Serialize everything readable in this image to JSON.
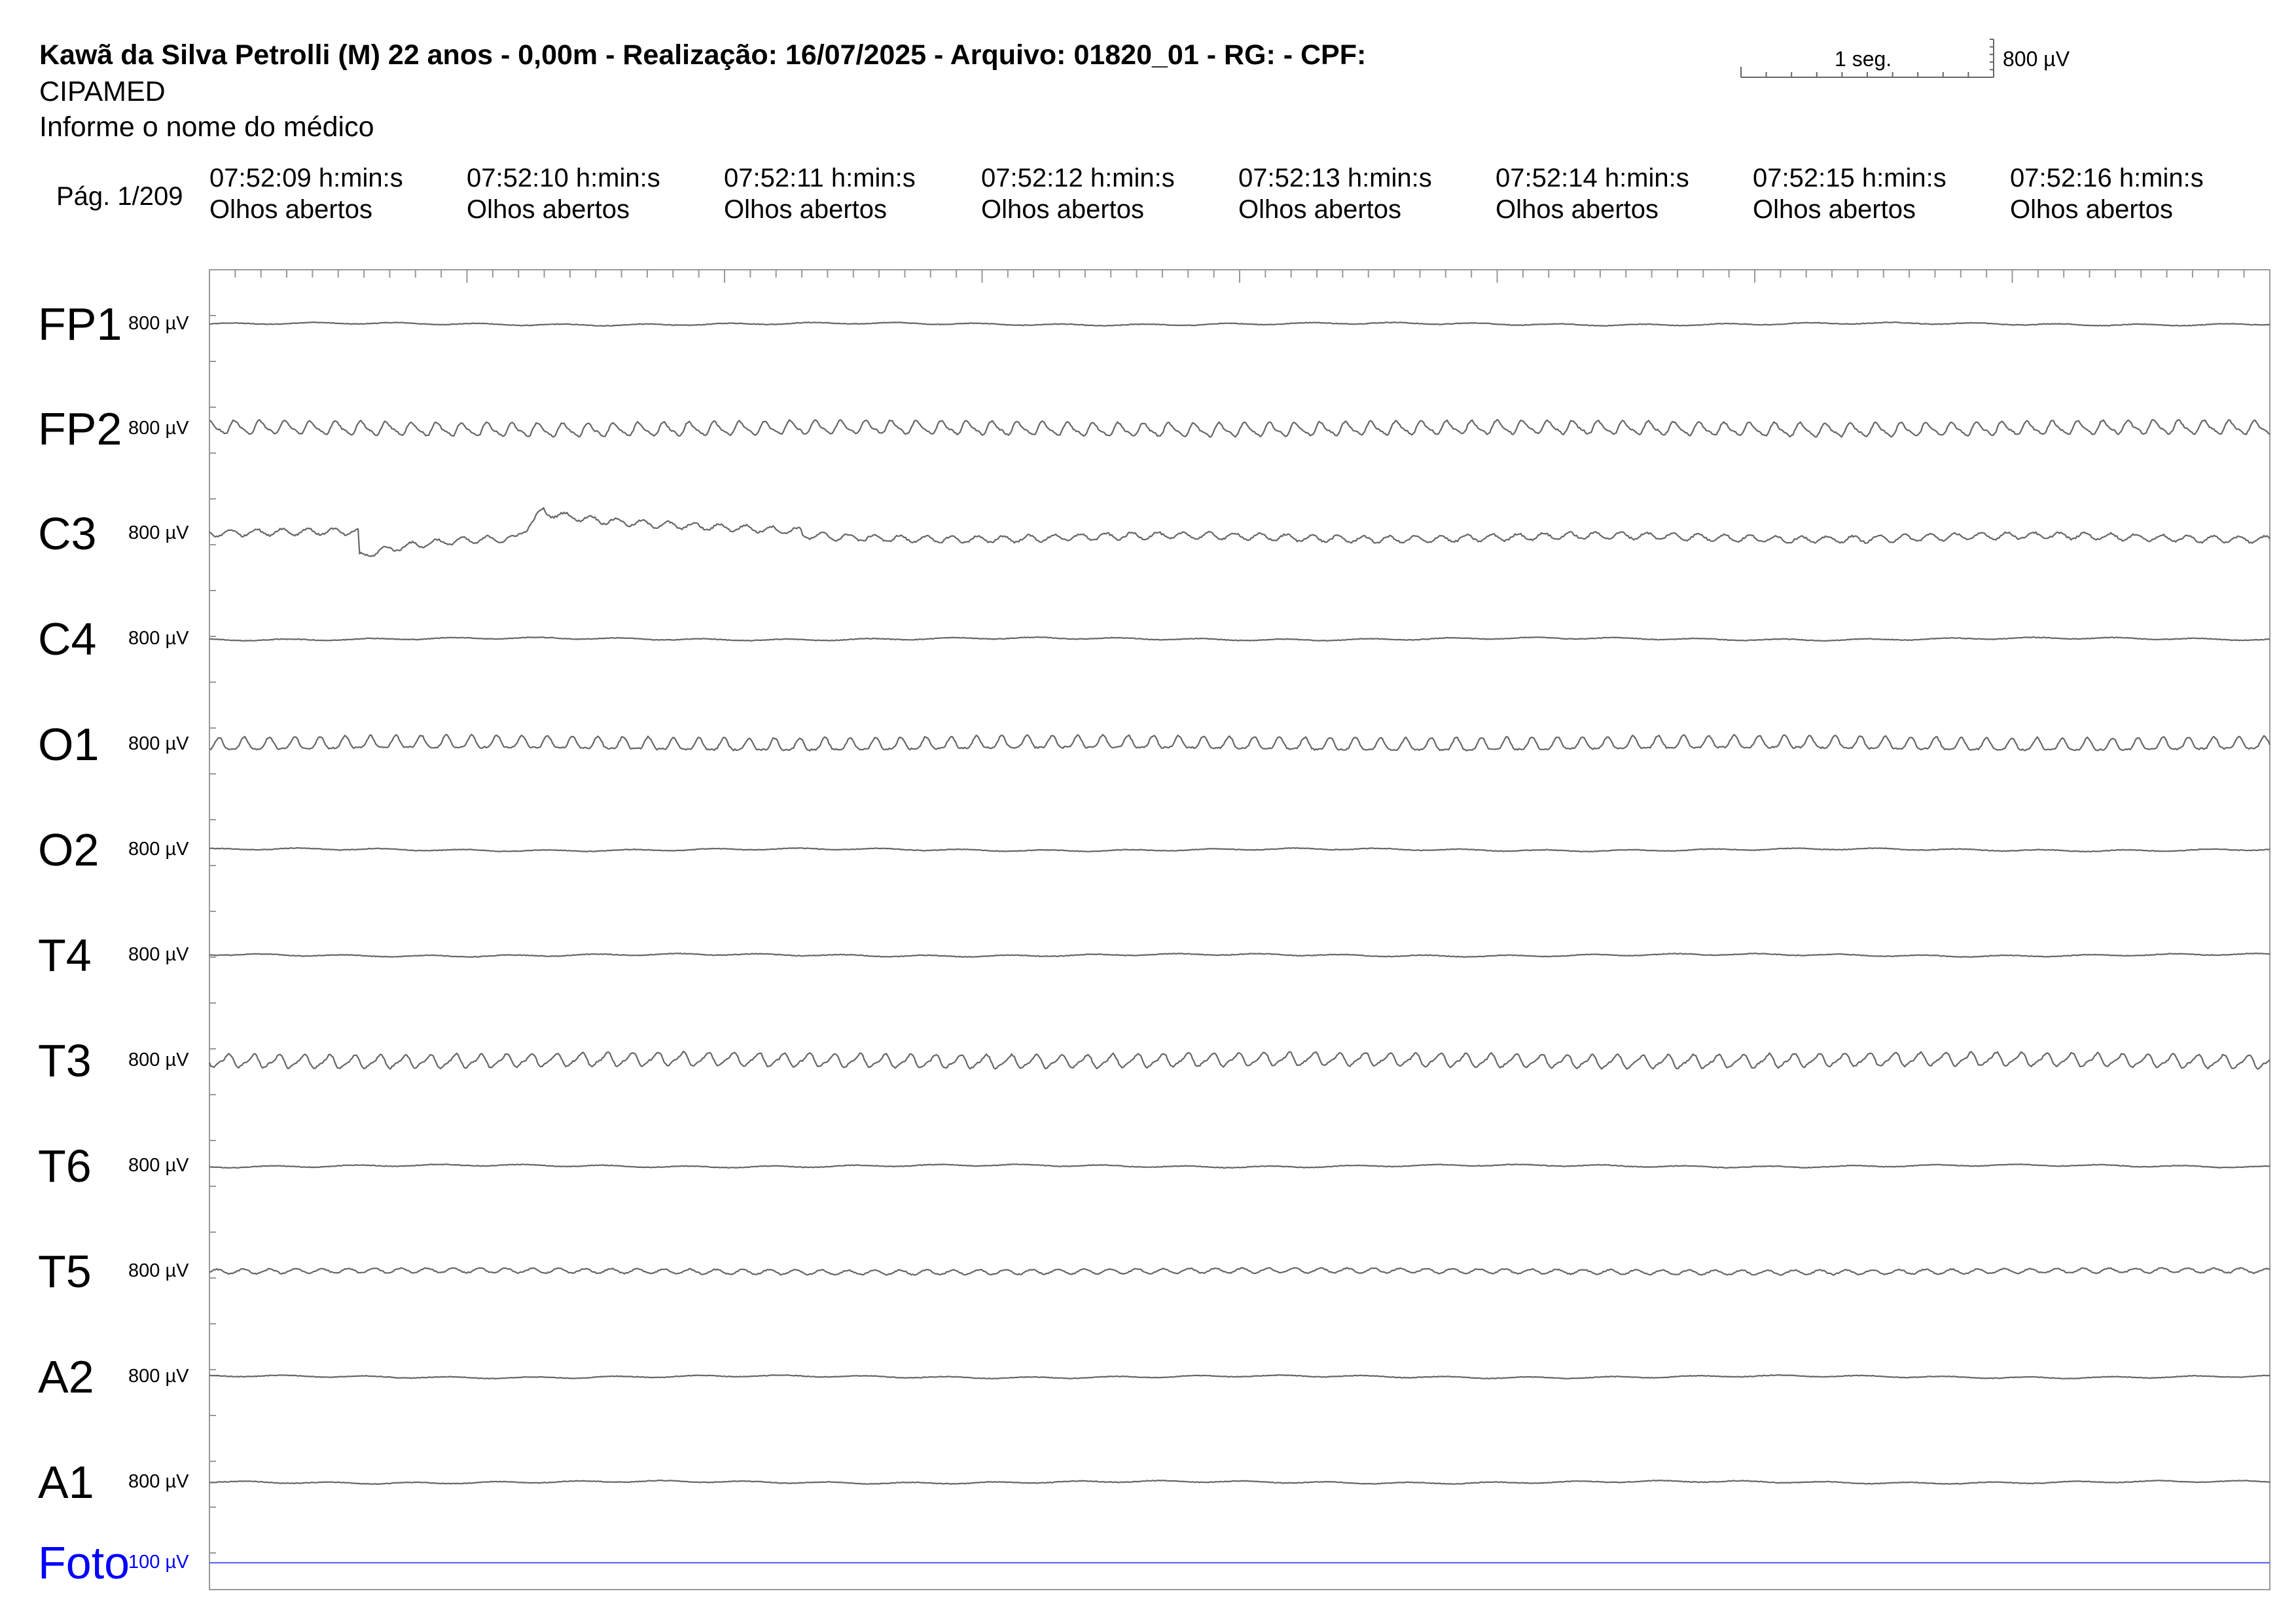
{
  "header": {
    "title": "Kawã da Silva Petrolli (M) 22 anos - 0,00m - Realização: 16/07/2025 - Arquivo: 01820_01 - RG:  - CPF:",
    "institution": "CIPAMED",
    "doctor": "Informe o nome do médico",
    "page": "Pág. 1/209"
  },
  "scale": {
    "time_label": "1 seg.",
    "amplitude_label": "800 µV"
  },
  "timestamps": [
    {
      "time": "07:52:09 h:min:s",
      "state": "Olhos abertos"
    },
    {
      "time": "07:52:10 h:min:s",
      "state": "Olhos abertos"
    },
    {
      "time": "07:52:11 h:min:s",
      "state": "Olhos abertos"
    },
    {
      "time": "07:52:12 h:min:s",
      "state": "Olhos abertos"
    },
    {
      "time": "07:52:13 h:min:s",
      "state": "Olhos abertos"
    },
    {
      "time": "07:52:14 h:min:s",
      "state": "Olhos abertos"
    },
    {
      "time": "07:52:15 h:min:s",
      "state": "Olhos abertos"
    },
    {
      "time": "07:52:16 h:min:s",
      "state": "Olhos abertos"
    }
  ],
  "colors": {
    "trace": "#666666",
    "photic": "#6666ff",
    "photic_label": "#0000ff",
    "frame": "#999999",
    "text": "#000000"
  },
  "chart_data": {
    "type": "line",
    "x_unit": "s",
    "x_range": [
      0,
      8
    ],
    "series": [
      {
        "name": "FP1",
        "sensitivity": "800 µV",
        "wave": "flat"
      },
      {
        "name": "FP2",
        "sensitivity": "800 µV",
        "wave": "alpha"
      },
      {
        "name": "C3",
        "sensitivity": "800 µV",
        "wave": "artifact"
      },
      {
        "name": "C4",
        "sensitivity": "800 µV",
        "wave": "flat"
      },
      {
        "name": "O1",
        "sensitivity": "800 µV",
        "wave": "alpha"
      },
      {
        "name": "O2",
        "sensitivity": "800 µV",
        "wave": "flat"
      },
      {
        "name": "T4",
        "sensitivity": "800 µV",
        "wave": "flat"
      },
      {
        "name": "T3",
        "sensitivity": "800 µV",
        "wave": "alpha"
      },
      {
        "name": "T6",
        "sensitivity": "800 µV",
        "wave": "flat"
      },
      {
        "name": "T5",
        "sensitivity": "800 µV",
        "wave": "low"
      },
      {
        "name": "A2",
        "sensitivity": "800 µV",
        "wave": "flat"
      },
      {
        "name": "A1",
        "sensitivity": "800 µV",
        "wave": "flat"
      },
      {
        "name": "Foto",
        "sensitivity": "100 µV",
        "wave": "photic"
      }
    ]
  }
}
